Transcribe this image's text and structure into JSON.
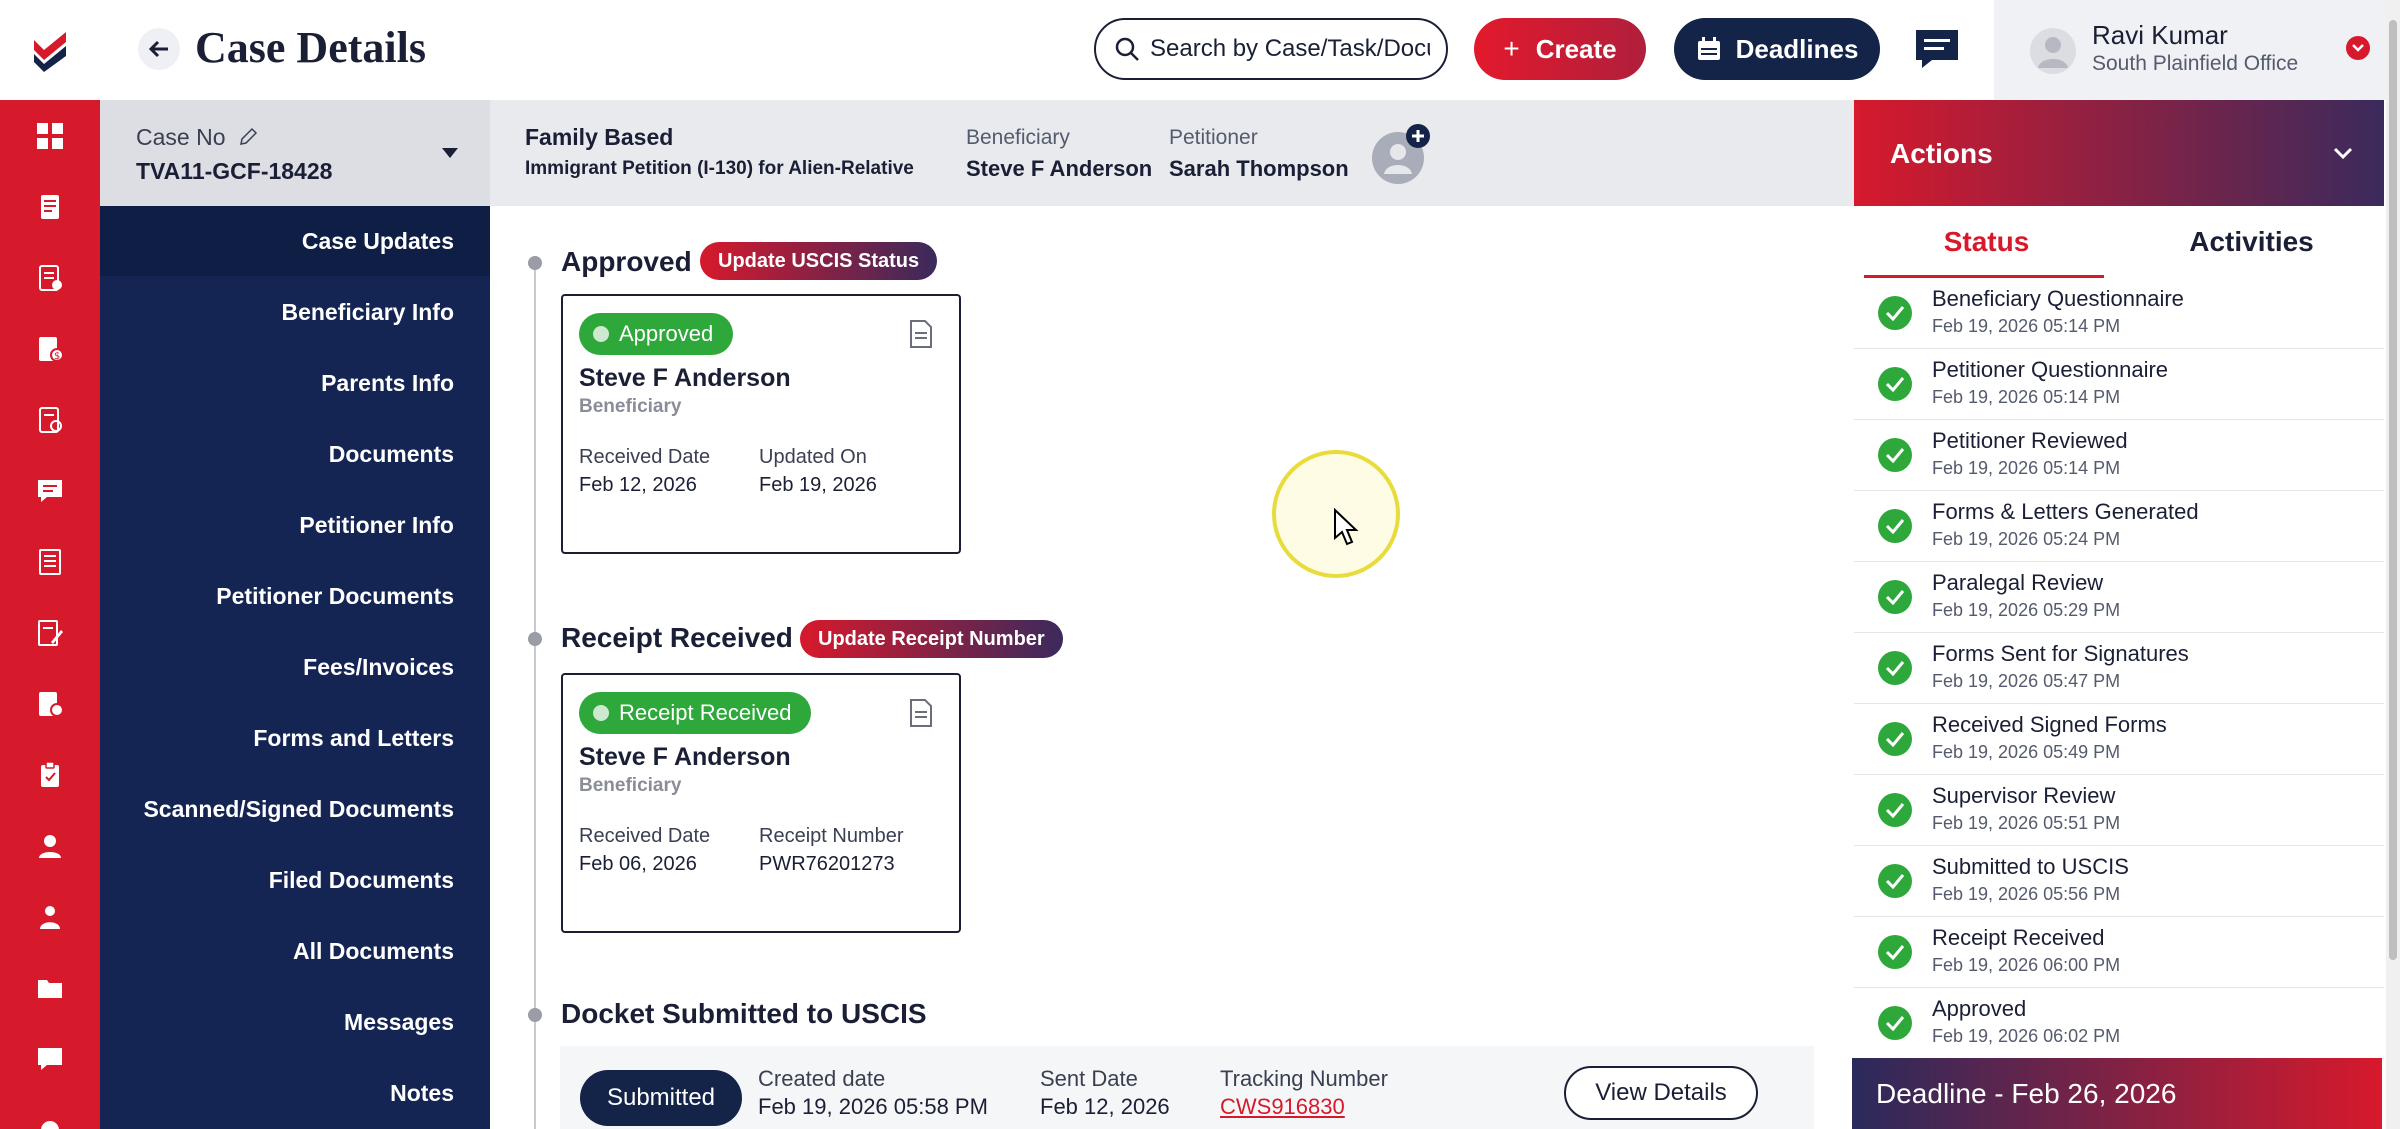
{
  "header": {
    "title": "Case Details",
    "search_placeholder": "Search by Case/Task/Document",
    "create_label": "Create",
    "deadlines_label": "Deadlines",
    "user_name": "Ravi Kumar",
    "user_office": "South Plainfield Office"
  },
  "case": {
    "case_no_label": "Case No",
    "case_no": "TVA11-GCF-18428",
    "type_title": "Family Based",
    "type_subtitle": "Immigrant Petition (I-130) for Alien-Relative",
    "beneficiary_label": "Beneficiary",
    "beneficiary": "Steve F Anderson",
    "petitioner_label": "Petitioner",
    "petitioner": "Sarah Thompson"
  },
  "nav": {
    "items": [
      "Case Updates",
      "Beneficiary Info",
      "Parents Info",
      "Documents",
      "Petitioner Info",
      "Petitioner Documents",
      "Fees/Invoices",
      "Forms and Letters",
      "Scanned/Signed Documents",
      "Filed Documents",
      "All Documents",
      "Messages",
      "Notes"
    ]
  },
  "timeline": {
    "approved": {
      "title": "Approved",
      "action": "Update USCIS Status",
      "status": "Approved",
      "name": "Steve F Anderson",
      "role": "Beneficiary",
      "label1": "Received Date",
      "value1": "Feb 12, 2026",
      "label2": "Updated On",
      "value2": "Feb 19, 2026"
    },
    "receipt": {
      "title": "Receipt Received",
      "action": "Update Receipt Number",
      "status": "Receipt Received",
      "name": "Steve F Anderson",
      "role": "Beneficiary",
      "label1": "Received Date",
      "value1": "Feb 06, 2026",
      "label2": "Receipt Number",
      "value2": "PWR76201273"
    },
    "docket": {
      "title": "Docket Submitted to USCIS",
      "status": "Submitted",
      "created_label": "Created date",
      "created_value": "Feb 19, 2026 05:58 PM",
      "sent_label": "Sent Date",
      "sent_value": "Feb 12, 2026",
      "tracking_label": "Tracking Number",
      "tracking_value": "CWS916830",
      "view_label": "View Details"
    }
  },
  "actions": {
    "title": "Actions",
    "tab_status": "Status",
    "tab_activities": "Activities",
    "items": [
      {
        "title": "Beneficiary Questionnaire",
        "date": "Feb 19, 2026 05:14 PM"
      },
      {
        "title": "Petitioner Questionnaire",
        "date": "Feb 19, 2026 05:14 PM"
      },
      {
        "title": "Petitioner Reviewed",
        "date": "Feb 19, 2026 05:14 PM"
      },
      {
        "title": "Forms & Letters Generated",
        "date": "Feb 19, 2026 05:24 PM"
      },
      {
        "title": "Paralegal Review",
        "date": "Feb 19, 2026 05:29 PM"
      },
      {
        "title": "Forms Sent for Signatures",
        "date": "Feb 19, 2026 05:47 PM"
      },
      {
        "title": "Received Signed Forms",
        "date": "Feb 19, 2026 05:49 PM"
      },
      {
        "title": "Supervisor Review",
        "date": "Feb 19, 2026 05:51 PM"
      },
      {
        "title": "Submitted to USCIS",
        "date": "Feb 19, 2026 05:56 PM"
      },
      {
        "title": "Receipt Received",
        "date": "Feb 19, 2026 06:00 PM"
      },
      {
        "title": "Approved",
        "date": "Feb 19, 2026 06:02 PM"
      }
    ],
    "deadline": "Deadline - Feb 26, 2026"
  },
  "colors": {
    "brand_red": "#d7192c",
    "navy": "#142553",
    "success_green": "#2ea83a"
  }
}
